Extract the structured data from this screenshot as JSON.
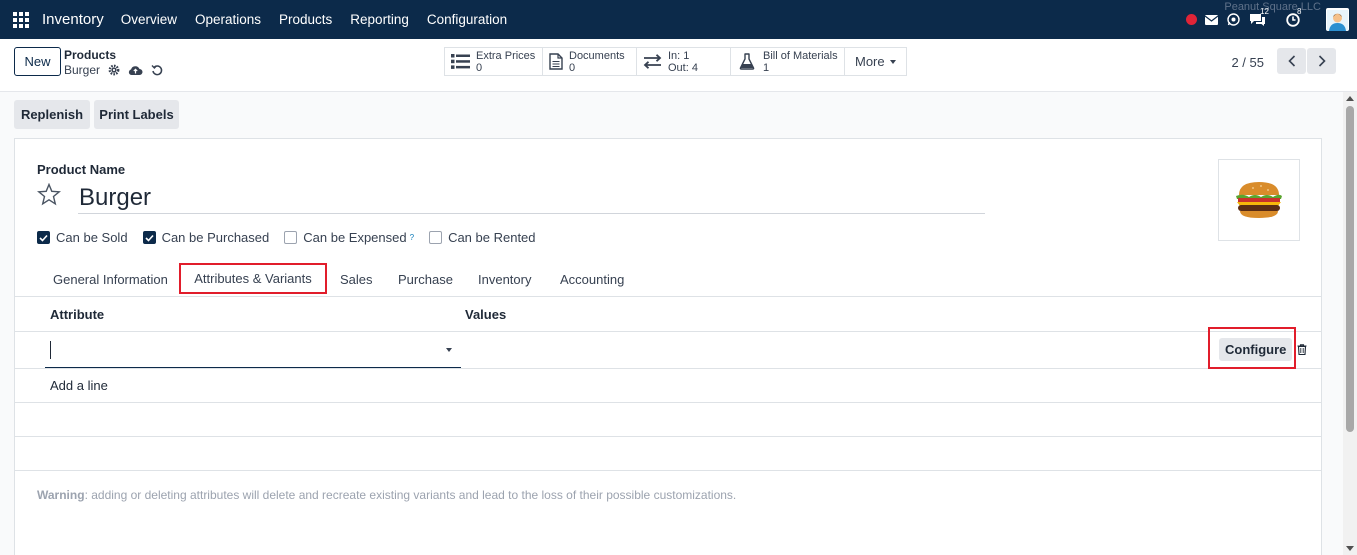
{
  "navbar": {
    "app_name": "Inventory",
    "menu": [
      "Overview",
      "Operations",
      "Products",
      "Reporting",
      "Configuration"
    ],
    "messages_count": "12",
    "activities_count": "8",
    "company": "Peanut Square LLC",
    "icons": [
      "apps-grid-icon",
      "record-dot-icon",
      "envelope-icon",
      "whatsapp-icon",
      "chat-icon",
      "clock-icon",
      "user-avatar"
    ]
  },
  "control": {
    "new_label": "New",
    "breadcrumb_parent": "Products",
    "breadcrumb_current": "Burger",
    "smart_buttons": [
      {
        "title": "Extra Prices",
        "value": "0",
        "icon": "list-icon"
      },
      {
        "title": "Documents",
        "value": "0",
        "icon": "document-icon"
      },
      {
        "title": "In: 1",
        "value": "Out: 4",
        "icon": "exchange-icon"
      },
      {
        "title": "Bill of Materials",
        "value": "1",
        "icon": "flask-icon"
      }
    ],
    "more_label": "More",
    "pager": "2 / 55"
  },
  "actions": {
    "replenish": "Replenish",
    "print_labels": "Print Labels"
  },
  "form": {
    "product_name_label": "Product Name",
    "product_name": "Burger",
    "checkboxes": [
      {
        "label": "Can be Sold",
        "checked": true
      },
      {
        "label": "Can be Purchased",
        "checked": true
      },
      {
        "label": "Can be Expensed",
        "checked": false,
        "help": "?"
      },
      {
        "label": "Can be Rented",
        "checked": false
      }
    ],
    "tabs": [
      "General Information",
      "Attributes & Variants",
      "Sales",
      "Purchase",
      "Inventory",
      "Accounting"
    ],
    "active_tab": "Attributes & Variants",
    "columns": {
      "attribute": "Attribute",
      "values": "Values"
    },
    "configure_label": "Configure",
    "add_line": "Add a line",
    "warning_label": "Warning",
    "warning_text": ": adding or deleting attributes will delete and recreate existing variants and lead to the loss of their possible customizations."
  },
  "colors": {
    "navbar": "#0c2a4a",
    "highlight": "#e11d2b",
    "checkbox": "#0c2a4a"
  }
}
